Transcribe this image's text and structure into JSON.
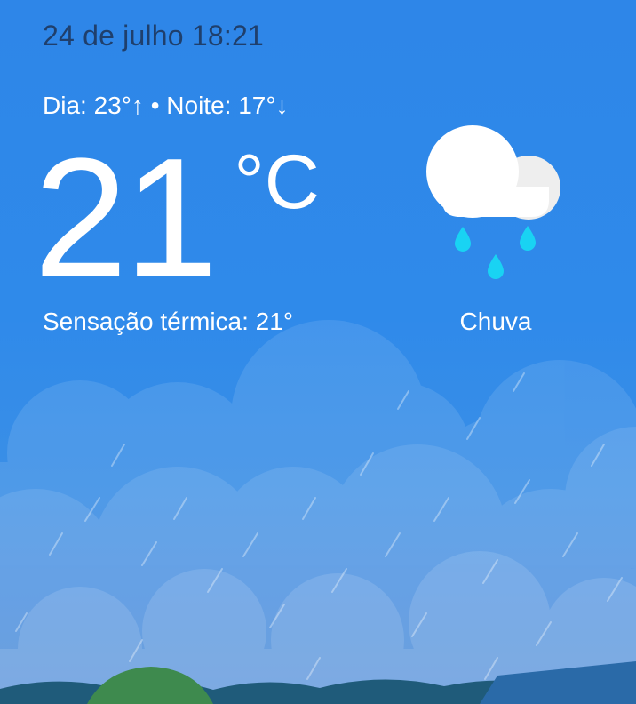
{
  "header": {
    "date_time": "24 de julho 18:21"
  },
  "summary": {
    "day_night": "Dia: 23°↑ • Noite: 17°↓",
    "temperature": "21",
    "unit": "°C",
    "feels_like": "Sensação térmica: 21°"
  },
  "condition": {
    "label": "Chuva",
    "icon": "rain-cloud-icon"
  },
  "colors": {
    "sky": "#2e86e8",
    "raindrop": "#19d3f3",
    "date_text": "#1f3f6c"
  }
}
